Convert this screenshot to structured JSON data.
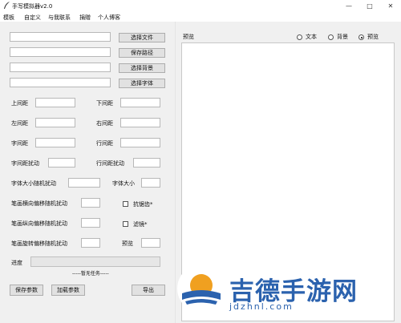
{
  "window": {
    "title": "手写模拟器v2.0",
    "minimize_glyph": "—",
    "maximize_glyph": "□",
    "close_glyph": "✕"
  },
  "menu": [
    "模板",
    "自定义",
    "与我联系",
    "捐赠",
    "个人博客"
  ],
  "file_buttons": [
    "选择文件",
    "保存路径",
    "选择背景",
    "选择字体"
  ],
  "fields": {
    "top_margin": "上间距",
    "bottom_margin": "下间距",
    "left_margin": "左间距",
    "right_margin": "右间距",
    "char_spacing": "字间距",
    "line_spacing": "行间距",
    "char_spacing_jitter": "字间距扰动",
    "line_spacing_jitter": "行间距扰动",
    "font_size_jitter": "字体大小随机扰动",
    "font_size": "字体大小",
    "stroke_h_jitter": "笔画横向偏移随机扰动",
    "stroke_v_jitter": "笔画纵向偏移随机扰动",
    "stroke_rot_jitter": "笔画旋转偏移随机扰动",
    "antialias": "抗锯齿*",
    "filter": "滤镜*",
    "preview_count": "预览"
  },
  "progress": {
    "label": "进度",
    "status": "-----暂无任务-----",
    "value": 0
  },
  "bottom_buttons": {
    "save_params": "保存参数",
    "load_params": "加载参数",
    "export": "导出"
  },
  "preview": {
    "label": "预览",
    "modes": [
      "文本",
      "背景",
      "预览"
    ],
    "selected_mode": "预览"
  },
  "watermark": {
    "brand": "吉德手游网",
    "url": "jdzhnl.com"
  },
  "colors": {
    "panel_bg": "#f0f0f0",
    "watermark_blue": "#2b62ae",
    "watermark_orange": "#f0a020"
  }
}
